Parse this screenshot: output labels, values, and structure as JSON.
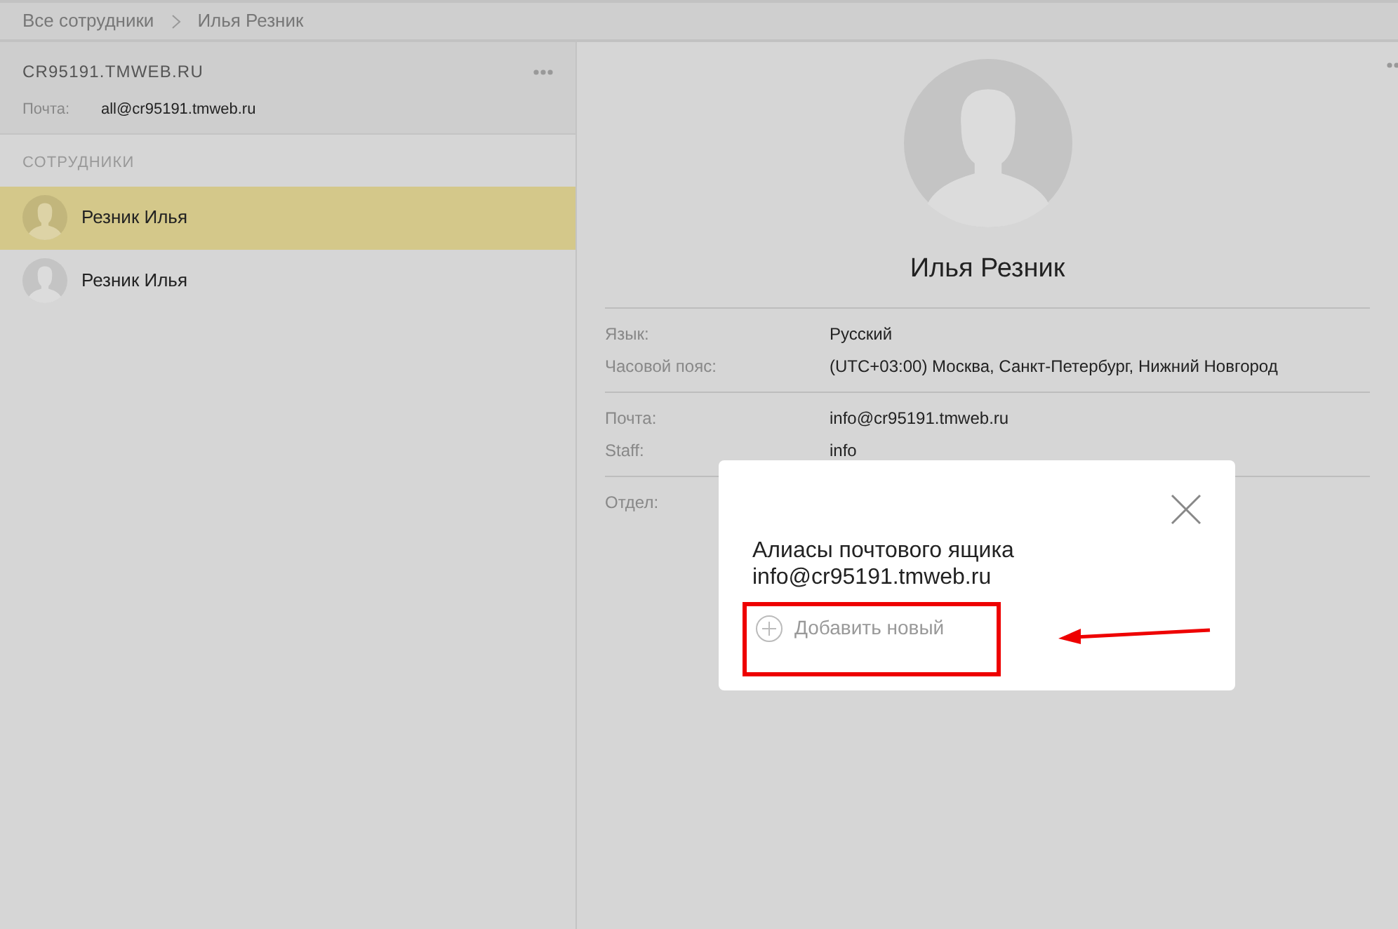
{
  "breadcrumbs": [
    {
      "label": "Все сотрудники"
    },
    {
      "label": "Илья Резник"
    }
  ],
  "organization": {
    "domain": "CR95191.TMWEB.RU",
    "mail_label": "Почта:",
    "mail_value": "all@cr95191.tmweb.ru"
  },
  "employees": {
    "heading": "СОТРУДНИКИ",
    "items": [
      {
        "name": "Резник Илья",
        "selected": true
      },
      {
        "name": "Резник Илья",
        "selected": false
      }
    ]
  },
  "profile": {
    "name": "Илья Резник",
    "groups": [
      [
        {
          "label": "Язык:",
          "value": "Русский"
        },
        {
          "label": "Часовой пояс:",
          "value": "(UTC+03:00) Москва, Санкт-Петербург, Нижний Новгород"
        }
      ],
      [
        {
          "label": "Почта:",
          "value": "info@cr95191.tmweb.ru"
        },
        {
          "label": "Staff:",
          "value": "info"
        }
      ],
      [
        {
          "label": "Отдел:"
        }
      ]
    ]
  },
  "dialog": {
    "title": "Алиасы почтового ящика",
    "subtitle": "info@cr95191.tmweb.ru",
    "add_label": "Добавить новый"
  }
}
